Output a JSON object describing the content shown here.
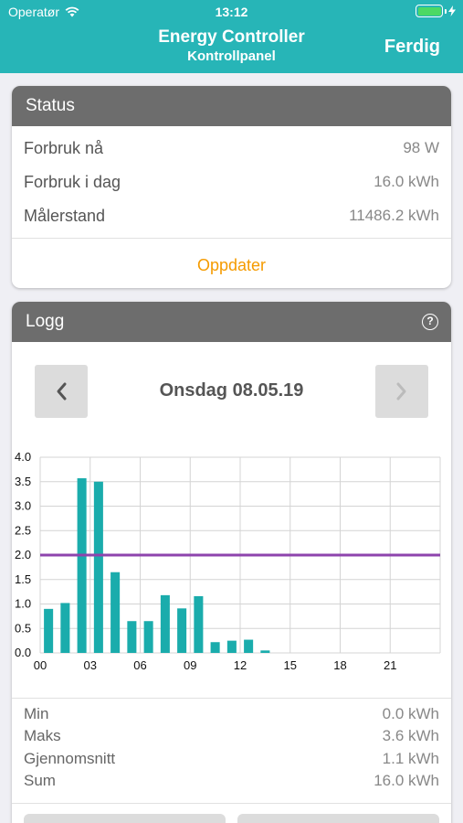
{
  "status_bar": {
    "carrier": "Operatør",
    "time": "13:12",
    "wifi_icon": "wifi-icon",
    "battery_icon": "battery-icon"
  },
  "nav": {
    "title": "Energy Controller",
    "subtitle": "Kontrollpanel",
    "done": "Ferdig"
  },
  "status": {
    "header": "Status",
    "rows": [
      {
        "label": "Forbruk nå",
        "value": "98 W"
      },
      {
        "label": "Forbruk i dag",
        "value": "16.0 kWh"
      },
      {
        "label": "Målerstand",
        "value": "11486.2 kWh"
      }
    ],
    "update": "Oppdater"
  },
  "log": {
    "header": "Logg",
    "help": "?",
    "date": "Onsdag 08.05.19",
    "stats": [
      {
        "label": "Min",
        "value": "0.0 kWh"
      },
      {
        "label": "Maks",
        "value": "3.6 kWh"
      },
      {
        "label": "Gjennomsnitt",
        "value": "1.1 kWh"
      },
      {
        "label": "Sum",
        "value": "16.0 kWh"
      }
    ]
  },
  "colors": {
    "accent": "#27b5b7",
    "bar": "#1aacac",
    "limit": "#8e44ad",
    "update": "#f59b00"
  },
  "chart_data": {
    "type": "bar",
    "x": [
      0,
      1,
      2,
      3,
      4,
      5,
      6,
      7,
      8,
      9,
      10,
      11,
      12,
      13,
      14,
      15,
      16,
      17,
      18,
      19,
      20,
      21,
      22,
      23
    ],
    "values": [
      0.9,
      1.02,
      3.57,
      3.5,
      1.65,
      0.65,
      0.65,
      1.18,
      0.91,
      1.16,
      0.22,
      0.25,
      0.27,
      0.05,
      0,
      0,
      0,
      0,
      0,
      0,
      0,
      0,
      0,
      0
    ],
    "limit": 2.0,
    "xticks": [
      "00",
      "03",
      "06",
      "09",
      "12",
      "15",
      "18",
      "21"
    ],
    "yticks": [
      "0.0",
      "0.5",
      "1.0",
      "1.5",
      "2.0",
      "2.5",
      "3.0",
      "3.5",
      "4.0"
    ],
    "ylim": [
      0,
      4
    ],
    "grid": true
  }
}
